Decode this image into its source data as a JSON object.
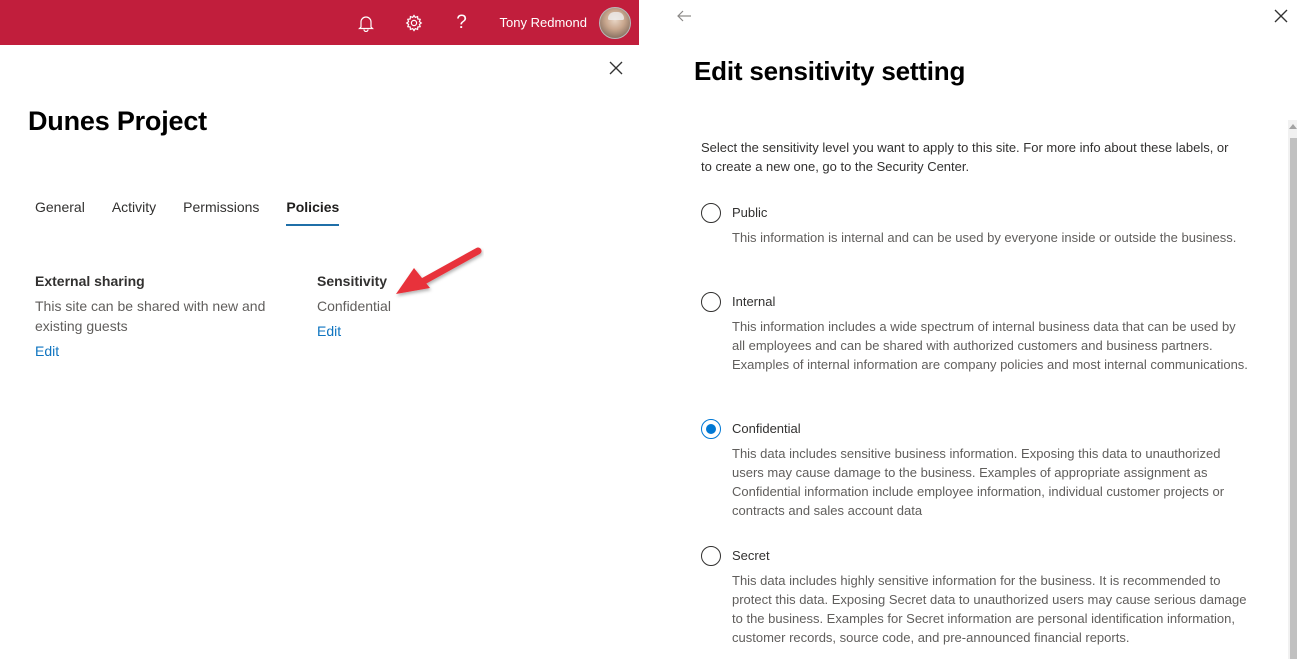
{
  "suite_bar": {
    "background_color": "#c11e3c",
    "icons": [
      {
        "name": "bell-icon",
        "label": "Notifications"
      },
      {
        "name": "gear-icon",
        "label": "Settings"
      },
      {
        "name": "help-icon",
        "label": "?"
      }
    ],
    "user_name": "Tony Redmond"
  },
  "site_panel": {
    "title": "Dunes Project",
    "tabs": [
      {
        "label": "General",
        "active": false
      },
      {
        "label": "Activity",
        "active": false
      },
      {
        "label": "Permissions",
        "active": false
      },
      {
        "label": "Policies",
        "active": true
      }
    ],
    "external_sharing": {
      "heading": "External sharing",
      "value": "This site can be shared with new and existing guests",
      "edit_label": "Edit"
    },
    "sensitivity": {
      "heading": "Sensitivity",
      "value": "Confidential",
      "edit_label": "Edit"
    },
    "annotation_color": "#e8333a"
  },
  "edit_panel": {
    "title": "Edit sensitivity setting",
    "intro": "Select the sensitivity level you want to apply to this site. For more info about these labels, or to create a new one, go to the Security Center.",
    "selected": "Confidential",
    "accent_color": "#0078d4",
    "options": [
      {
        "label": "Public",
        "checked": false,
        "description": "This information is internal and can be used by everyone inside or outside the business."
      },
      {
        "label": "Internal",
        "checked": false,
        "description": "This information includes a wide spectrum of internal business data that can be used by all employees and can be shared with authorized customers and business partners. Examples of internal information are company policies and most internal communications."
      },
      {
        "label": "Confidential",
        "checked": true,
        "description": "This data includes sensitive business information. Exposing this data to unauthorized users may cause damage to the business. Examples of appropriate assignment as Confidential information include employee information, individual customer projects or contracts and sales account data"
      },
      {
        "label": "Secret",
        "checked": false,
        "description": "This data includes highly sensitive information for the business. It is recommended to protect this data. Exposing Secret data to unauthorized users may cause serious damage to the business. Examples for Secret information are personal identification information, customer records, source code, and pre-announced financial reports."
      }
    ]
  }
}
